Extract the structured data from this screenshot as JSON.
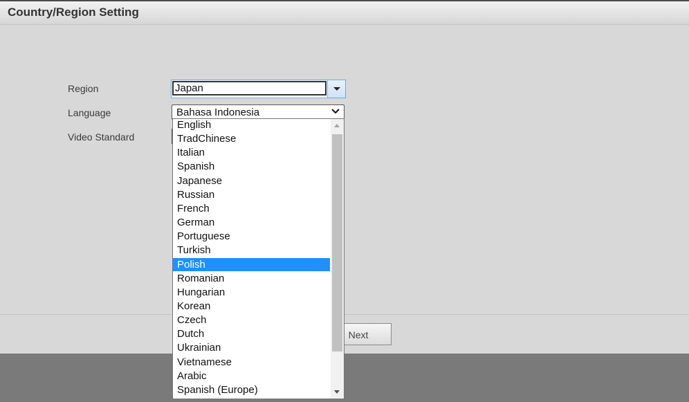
{
  "header": {
    "title": "Country/Region Setting"
  },
  "form": {
    "region_label": "Region",
    "region_value": "Japan",
    "language_label": "Language",
    "language_value": "Bahasa Indonesia",
    "video_standard_label": "Video Standard"
  },
  "buttons": {
    "next_label": "Next"
  },
  "language_dropdown": {
    "options": [
      "English",
      "TradChinese",
      "Italian",
      "Spanish",
      "Japanese",
      "Russian",
      "French",
      "German",
      "Portuguese",
      "Turkish",
      "Polish",
      "Romanian",
      "Hungarian",
      "Korean",
      "Czech",
      "Dutch",
      "Ukrainian",
      "Vietnamese",
      "Arabic",
      "Spanish (Europe)"
    ],
    "highlighted": "Polish"
  },
  "colors": {
    "highlight": "#1e90ff",
    "panel_background": "#d8d8d8",
    "footer_background": "#7a7a7a"
  }
}
